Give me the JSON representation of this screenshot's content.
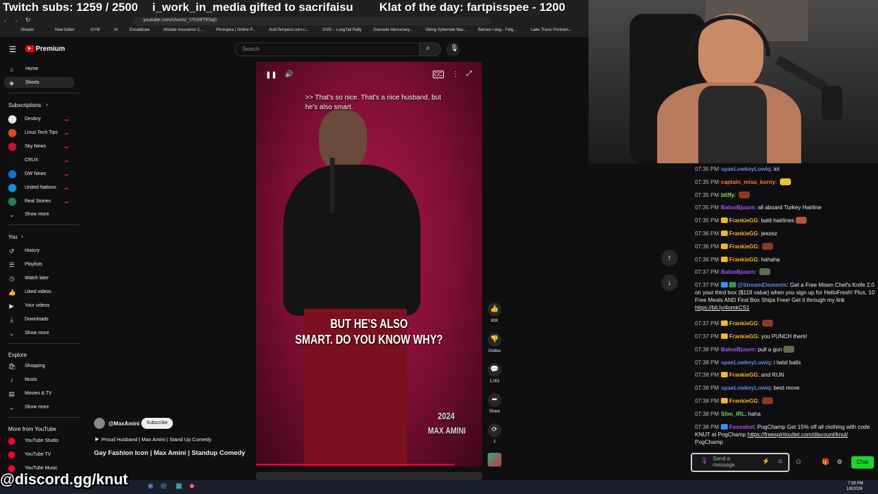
{
  "overlay": {
    "subs": "Twitch subs: 1259 / 2500",
    "gifted": "i_work_in_media gifted to sacrifaisu",
    "klat": "Klat of the day: fartpisspee - 1200",
    "discord": "@discord.gg/knut"
  },
  "browser": {
    "url": "youtube.com/shorts/_I7hSRTEhq0",
    "bookmarks": [
      "Stream",
      "New folder",
      "GYM",
      "AI",
      "Excalidraw",
      "Allstate Insurance C...",
      "Photopea | Online P...",
      "AutoTempest.com:c...",
      "2025 – LongTail Rally",
      "Grenade Mercenary...",
      "Viking Sytternde Mai...",
      "Børsen i dag - Følg...",
      "Lake Travis Pontoon..."
    ]
  },
  "youtube": {
    "logo": "Premium",
    "search_placeholder": "Search",
    "nav": [
      {
        "label": "Home",
        "icon": "home-icon",
        "glyph": "⌂"
      },
      {
        "label": "Shorts",
        "icon": "shorts-icon",
        "glyph": "◈"
      }
    ],
    "subscriptions_heading": "Subscriptions",
    "subscriptions": [
      {
        "label": "Destiny",
        "color": "#e6e6e6"
      },
      {
        "label": "Linus Tech Tips",
        "color": "#d9482b"
      },
      {
        "label": "Sky News",
        "color": "#c0142c"
      },
      {
        "label": "CRUX",
        "color": "#111111"
      },
      {
        "label": "DW News",
        "color": "#1e6bd1"
      },
      {
        "label": "United Nations",
        "color": "#1a8dd6"
      },
      {
        "label": "Real Stories",
        "color": "#2a7a5c"
      }
    ],
    "show_more": "Show more",
    "you_heading": "You",
    "you_items": [
      {
        "label": "History",
        "glyph": "↺"
      },
      {
        "label": "Playlists",
        "glyph": "☰"
      },
      {
        "label": "Watch later",
        "glyph": "◷"
      },
      {
        "label": "Liked videos",
        "glyph": "👍"
      },
      {
        "label": "Your videos",
        "glyph": "▶"
      },
      {
        "label": "Downloads",
        "glyph": "⤓"
      }
    ],
    "explore_heading": "Explore",
    "explore_items": [
      {
        "label": "Shopping",
        "glyph": "🛍"
      },
      {
        "label": "Music",
        "glyph": "♪"
      },
      {
        "label": "Movies & TV",
        "glyph": "▤"
      }
    ],
    "more_heading": "More from YouTube",
    "more_items": [
      {
        "label": "YouTube Studio"
      },
      {
        "label": "YouTube TV"
      },
      {
        "label": "YouTube Music"
      }
    ],
    "short": {
      "caption_top": ">> That's so nice. That's a nice husband, but he's also smart.",
      "caption_big_1": "BUT HE'S ALSO",
      "caption_big_2": "SMART. DO YOU KNOW WHY?",
      "watermark_year": "2024",
      "watermark_name": "MAX AMINI",
      "channel": "@MaxAmini",
      "subscribe": "Subscribe",
      "playlist": "Proud Husband | Max Amini | Stand Up Comedy",
      "title": "Gay Fashion Icon | Max Amini | Standup Comedy",
      "likes": "83K",
      "dislike": "Dislike",
      "comments": "1,001",
      "share": "Share",
      "remix": "1"
    }
  },
  "chat": {
    "messages": [
      {
        "time": "07:35 PM",
        "user": "spaeLowkeyLowiq",
        "color": "#5b8ae6",
        "text": "lol",
        "emote": false
      },
      {
        "time": "07:35 PM",
        "user": "captain_miso_korny",
        "color": "#ff7f27",
        "text": "",
        "emote": "#e8c33a"
      },
      {
        "time": "07:35 PM",
        "user": "bliffy",
        "color": "#8be04e",
        "text": "",
        "emote": "#8a3a22"
      },
      {
        "time": "07:35 PM",
        "user": "BalooBjuurn",
        "color": "#9b5cf5",
        "text": "all aboard Turkey Hairline",
        "emote": false
      },
      {
        "time": "07:35 PM",
        "user": "FrankieGG",
        "color": "#f3b521",
        "text": "bald hairlines",
        "emote": "#b5543c",
        "badge": true
      },
      {
        "time": "07:36 PM",
        "user": "FrankieGG",
        "color": "#f3b521",
        "text": "jeezez",
        "emote": false,
        "badge": true
      },
      {
        "time": "07:36 PM",
        "user": "FrankieGG",
        "color": "#f3b521",
        "text": "",
        "emote": "#8a3a22",
        "badge": true
      },
      {
        "time": "07:36 PM",
        "user": "FrankieGG",
        "color": "#f3b521",
        "text": "hahaha",
        "emote": false,
        "badge": true
      },
      {
        "time": "07:37 PM",
        "user": "BalooBjuurn",
        "color": "#9b5cf5",
        "text": "",
        "emote": "#5e6d4a"
      }
    ],
    "se_time": "07:37 PM",
    "se_user": "@StreamElements",
    "se_text": "Get a Free Misen Chef's Knife 2.0 on your third box ($119 value) when you sign up for HelloFresh! Plus, 10 Free Meals AND First Box Ships Free! Get it through my link",
    "se_link": "https://bit.ly/4omkCS1",
    "messages2": [
      {
        "time": "07:37 PM",
        "user": "FrankieGG",
        "color": "#f3b521",
        "text": "",
        "emote": "#8a3a22",
        "badge": true
      },
      {
        "time": "07:37 PM",
        "user": "FrankieGG",
        "color": "#f3b521",
        "text": "you PUNCH them!",
        "emote": false,
        "badge": true
      },
      {
        "time": "07:38 PM",
        "user": "BalooBjuurn",
        "color": "#9b5cf5",
        "text": "pull a gun",
        "emote": "#5e6d4a"
      },
      {
        "time": "07:38 PM",
        "user": "spaeLowkeyLowiq",
        "color": "#5b8ae6",
        "text": "i twist balls",
        "emote": false
      },
      {
        "time": "07:38 PM",
        "user": "FrankieGG",
        "color": "#f3b521",
        "text": "and RUN",
        "emote": false,
        "badge": true
      },
      {
        "time": "07:38 PM",
        "user": "spaeLowkeyLowiq",
        "color": "#5b8ae6",
        "text": "best move",
        "emote": false
      },
      {
        "time": "07:38 PM",
        "user": "FrankieGG",
        "color": "#f3b521",
        "text": "",
        "emote": "#8a3a22",
        "badge": true
      },
      {
        "time": "07:38 PM",
        "user": "Slim_IRL",
        "color": "#6ad46a",
        "text": "haha",
        "emote": false
      }
    ],
    "fb_time": "07:38 PM",
    "fb_user": "Fossabot",
    "fb_text": "PogChamp Get 15% off all clothing with code KNUT at PogChamp",
    "fb_link": "https://freespiritoutlet.com/discount/knut/",
    "fb_tail": "PogChamp",
    "input_placeholder": "Send a message",
    "chat_button": "Chat"
  },
  "taskbar": {
    "time": "7:39 PM",
    "date": "1/9/2026"
  }
}
